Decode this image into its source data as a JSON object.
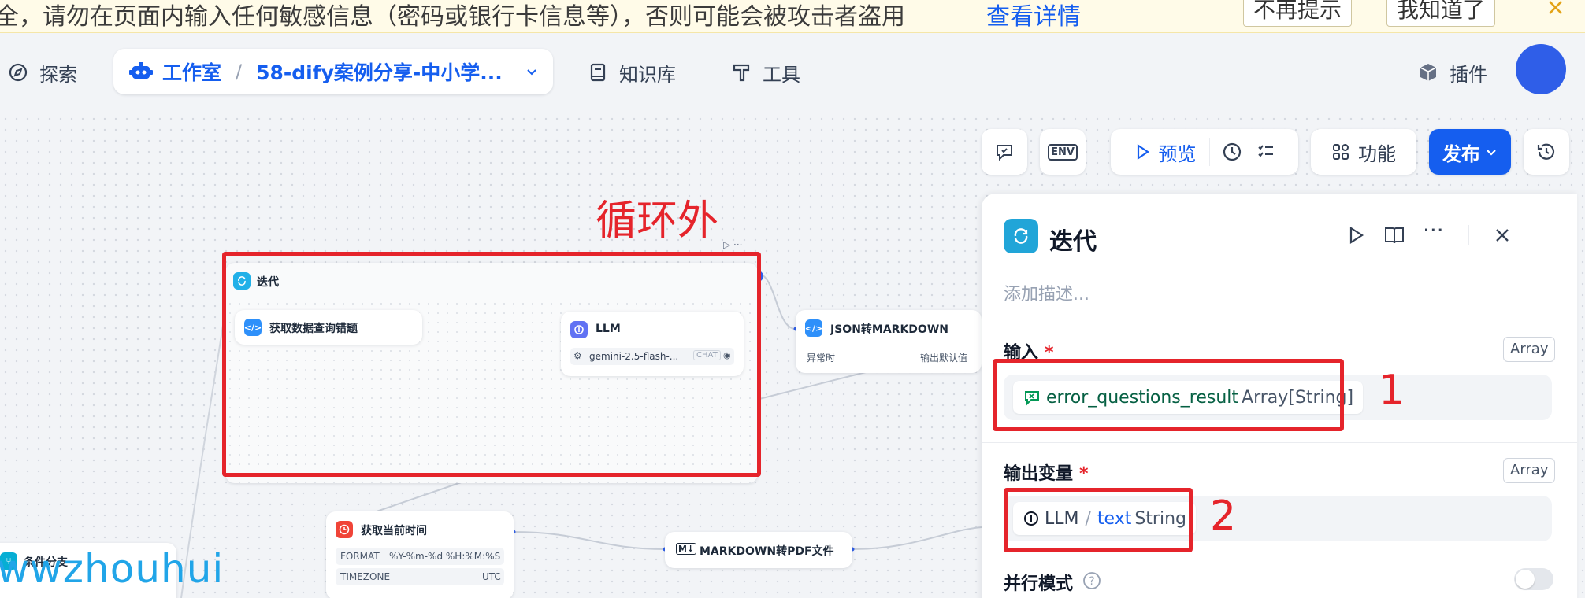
{
  "banner": {
    "text": "全，请勿在页面内输入任何敏感信息（密码或银行卡信息等），否则可能会被攻击者盗用",
    "link": "查看详情",
    "dont_remind": "不再提示",
    "got_it": "我知道了",
    "close": "×"
  },
  "nav": {
    "explore": "探索",
    "studio": "工作室",
    "app_name": "58-dify案例分享-中小学...",
    "knowledge": "知识库",
    "tools": "工具",
    "plugins": "插件"
  },
  "toolbar": {
    "env": "ENV",
    "preview": "预览",
    "features": "功能",
    "publish": "发布"
  },
  "canvas": {
    "iteration_node": {
      "title": "迭代"
    },
    "fetch_node": {
      "title": "获取数据查询错题"
    },
    "llm_node": {
      "title": "LLM",
      "model": "gemini-2.5-flash-...",
      "badge": "CHAT"
    },
    "json_node": {
      "title": "JSON转MARKDOWN",
      "k1": "异常时",
      "v1": "输出默认值"
    },
    "time_node": {
      "title": "获取当前时间",
      "format_key": "FORMAT",
      "format_val": "%Y-%m-%d %H:%M:%S",
      "tz_key": "TIMEZONE",
      "tz_val": "UTC"
    },
    "pdf_node": {
      "title": "MARKDOWN转PDF文件",
      "badge": "M↓"
    },
    "branch_node": {
      "title": "条件分支"
    },
    "annotation_outside": "循环外"
  },
  "panel": {
    "title": "迭代",
    "description_placeholder": "添加描述...",
    "input_label": "输入",
    "input_type": "Array",
    "input_var": "error_questions_result",
    "input_var_type": "Array[String]",
    "output_label": "输出变量",
    "output_type": "Array",
    "output_node": "LLM",
    "output_sep": "/",
    "output_var": "text",
    "output_var_type": "String",
    "parallel_label": "并行模式",
    "required_mark": "*"
  },
  "annotations": {
    "one": "1",
    "two": "2"
  },
  "watermark": "wwzhouhui",
  "colors": {
    "accent": "#155eef",
    "annotation_red": "#e5242b",
    "banner_bg": "#fffbe8"
  }
}
